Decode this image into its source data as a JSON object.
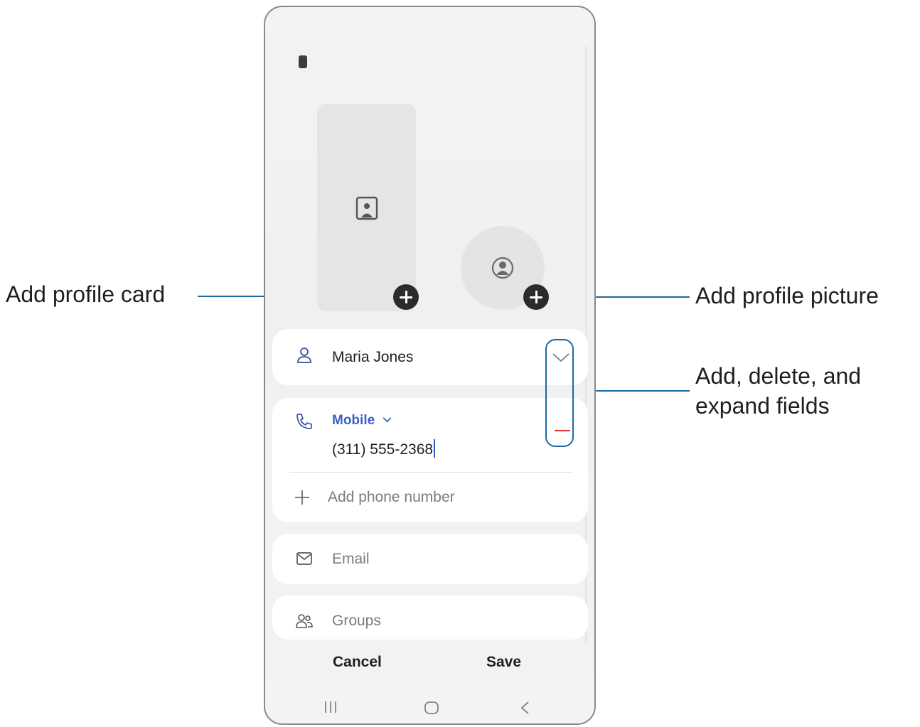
{
  "callouts": {
    "profile_card": "Add profile card",
    "profile_picture": "Add profile picture",
    "fields_line1": "Add, delete, and",
    "fields_line2": "expand fields"
  },
  "contact": {
    "name": "Maria Jones",
    "phone_label": "Mobile",
    "phone_value": "(311) 555-2368",
    "add_phone_placeholder": "Add phone number",
    "email_placeholder": "Email",
    "groups_placeholder": "Groups"
  },
  "actions": {
    "cancel": "Cancel",
    "save": "Save"
  },
  "icons": {
    "person": "person-icon",
    "phone": "phone-icon",
    "email": "envelope-icon",
    "groups": "groups-icon",
    "expand": "chevron-down-icon",
    "delete": "minus-icon",
    "add": "plus-icon"
  },
  "colors": {
    "accent_callout": "#1b6aa4",
    "label_blue": "#3b62c4",
    "delete_red": "#e03535"
  }
}
